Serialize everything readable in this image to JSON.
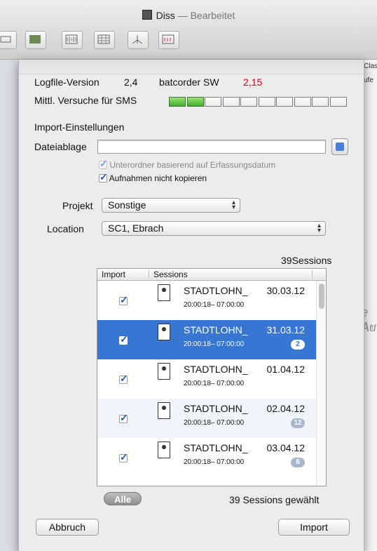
{
  "window": {
    "title": "Diss",
    "subtitle": "— Bearbeitet"
  },
  "background": {
    "right_col_1": "Clas",
    "right_col_2": "ufe",
    "right_hint": "e Aufna",
    "right_hint2": "n m"
  },
  "sheet": {
    "logfile_label": "Logfile-Version",
    "logfile_value": "2,4",
    "batcorder_label": "batcorder SW",
    "batcorder_value": "2,15",
    "sms_label": "Mittl. Versuche für SMS",
    "sms_meter": {
      "filled": 2,
      "total": 10
    },
    "import_heading": "Import-Einstellungen",
    "dateiablage_label": "Dateiablage",
    "dateiablage_value": "",
    "unterordner_label": "Unterordner basierend auf Erfassungsdatum",
    "nicht_kopieren_label": "Aufnahmen nicht kopieren",
    "projekt_label": "Projekt",
    "projekt_value": "Sonstige",
    "location_label": "Location",
    "location_value": "SC1, Ebrach",
    "sessions_count_top": "39Sessions",
    "table": {
      "col_import": "Import",
      "col_sessions": "Sessions",
      "rows": [
        {
          "name": "STADTLOHN_",
          "date": "30.03.12",
          "time": "20:00:18– 07:00:00",
          "badge": ""
        },
        {
          "name": "STADTLOHN_",
          "date": "31.03.12",
          "time": "20:00:18– 07:00:00",
          "badge": "2"
        },
        {
          "name": "STADTLOHN_",
          "date": "01.04.12",
          "time": "20:00:18– 07:00:00",
          "badge": ""
        },
        {
          "name": "STADTLOHN_",
          "date": "02.04.12",
          "time": "20:00:18– 07:00:00",
          "badge": "12"
        },
        {
          "name": "STADTLOHN_",
          "date": "03.04.12",
          "time": "20:00:18– 07:00:00",
          "badge": "6"
        }
      ]
    },
    "alle_label": "Alle",
    "selected_count": "39 Sessions gewählt",
    "cancel_label": "Abbruch",
    "import_label": "Import"
  },
  "colors": {
    "selection": "#3876d4",
    "accent_red": "#d0021b",
    "meter_green": "#4cb83a"
  }
}
